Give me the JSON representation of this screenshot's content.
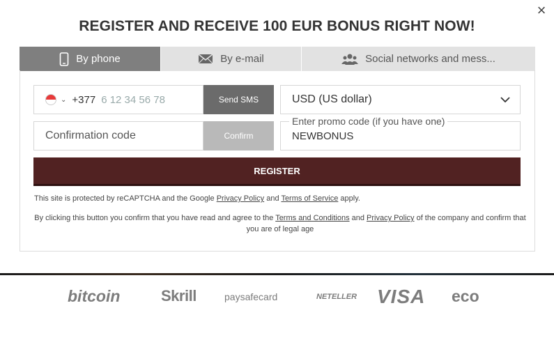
{
  "title": "REGISTER AND RECEIVE 100 EUR BONUS RIGHT NOW!",
  "close_label": "×",
  "tabs": [
    {
      "label": "By phone",
      "icon": "phone-icon"
    },
    {
      "label": "By e-mail",
      "icon": "envelope-icon"
    },
    {
      "label": "Social networks and mess...",
      "icon": "users-icon"
    }
  ],
  "phone": {
    "prefix": "+377",
    "placeholder": "6 12 34 56 78",
    "country_flag": "monaco-flag-icon"
  },
  "send_sms_label": "Send SMS",
  "currency": {
    "selected": "USD (US dollar)"
  },
  "confirmation": {
    "placeholder": "Confirmation code"
  },
  "confirm_label": "Confirm",
  "promo": {
    "label": "Enter promo code (if you have one)",
    "value": "NEWBONUS"
  },
  "register_label": "REGISTER",
  "recaptcha_note": {
    "prefix": "This site is protected by reCAPTCHA and the Google ",
    "privacy": "Privacy Policy",
    "and": " and ",
    "terms": "Terms of Service",
    "suffix": " apply."
  },
  "agree_note": {
    "prefix": "By clicking this button you confirm that you have read and agree to the ",
    "terms": "Terms and Conditions",
    "and": " and ",
    "privacy": "Privacy Policy",
    "suffix": " of the company and confirm that you are of legal age"
  },
  "payments": [
    "bitcoin",
    "Skrill",
    "paysafecard",
    "NETELLER",
    "VISA",
    "eco"
  ],
  "colors": {
    "register": "#512222",
    "tab_active": "#7f7f7f",
    "tab_inactive": "#e2e2e2",
    "send_sms": "#6b6b6b",
    "confirm": "#b9b9b9"
  }
}
